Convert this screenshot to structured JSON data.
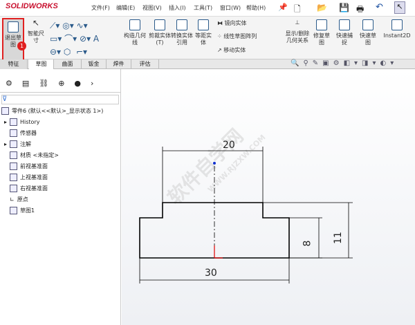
{
  "app": {
    "logo": "SOLIDWORKS"
  },
  "menu": [
    "文件(F)",
    "编辑(E)",
    "视图(V)",
    "插入(I)",
    "工具(T)",
    "窗口(W)",
    "帮助(H)"
  ],
  "ribbon": {
    "exit_sketch": "退出草图",
    "smart_dim": "智能尺寸",
    "construction": "构造几何线",
    "trim": "剪裁实体(T)",
    "convert": "转换实体引用",
    "offset": "等距实体",
    "mirror": "镜向实体",
    "linear_pattern": "线性草图阵列",
    "move": "移动实体",
    "display_relations": "显示/删除几何关系",
    "repair": "修复草图",
    "quick_snap": "快速捕捉",
    "rapid_sketch": "快速草图",
    "instant2d": "Instant2D",
    "badge": "1"
  },
  "tabs": [
    "特征",
    "草图",
    "曲面",
    "钣金",
    "焊件",
    "评估"
  ],
  "tree": {
    "root": "零件6 (默认<<默认>_显示状态 1>)",
    "items": [
      "History",
      "传感器",
      "注解",
      "材质 <未指定>",
      "前视基准面",
      "上视基准面",
      "右视基准面",
      "原点",
      "草图1"
    ]
  },
  "sketch": {
    "dims": {
      "top": "20",
      "bottom": "30",
      "right_inner": "8",
      "right_outer": "11"
    }
  },
  "watermark": {
    "text": "软件自学网",
    "url": "WWW.RJZXW.COM"
  }
}
